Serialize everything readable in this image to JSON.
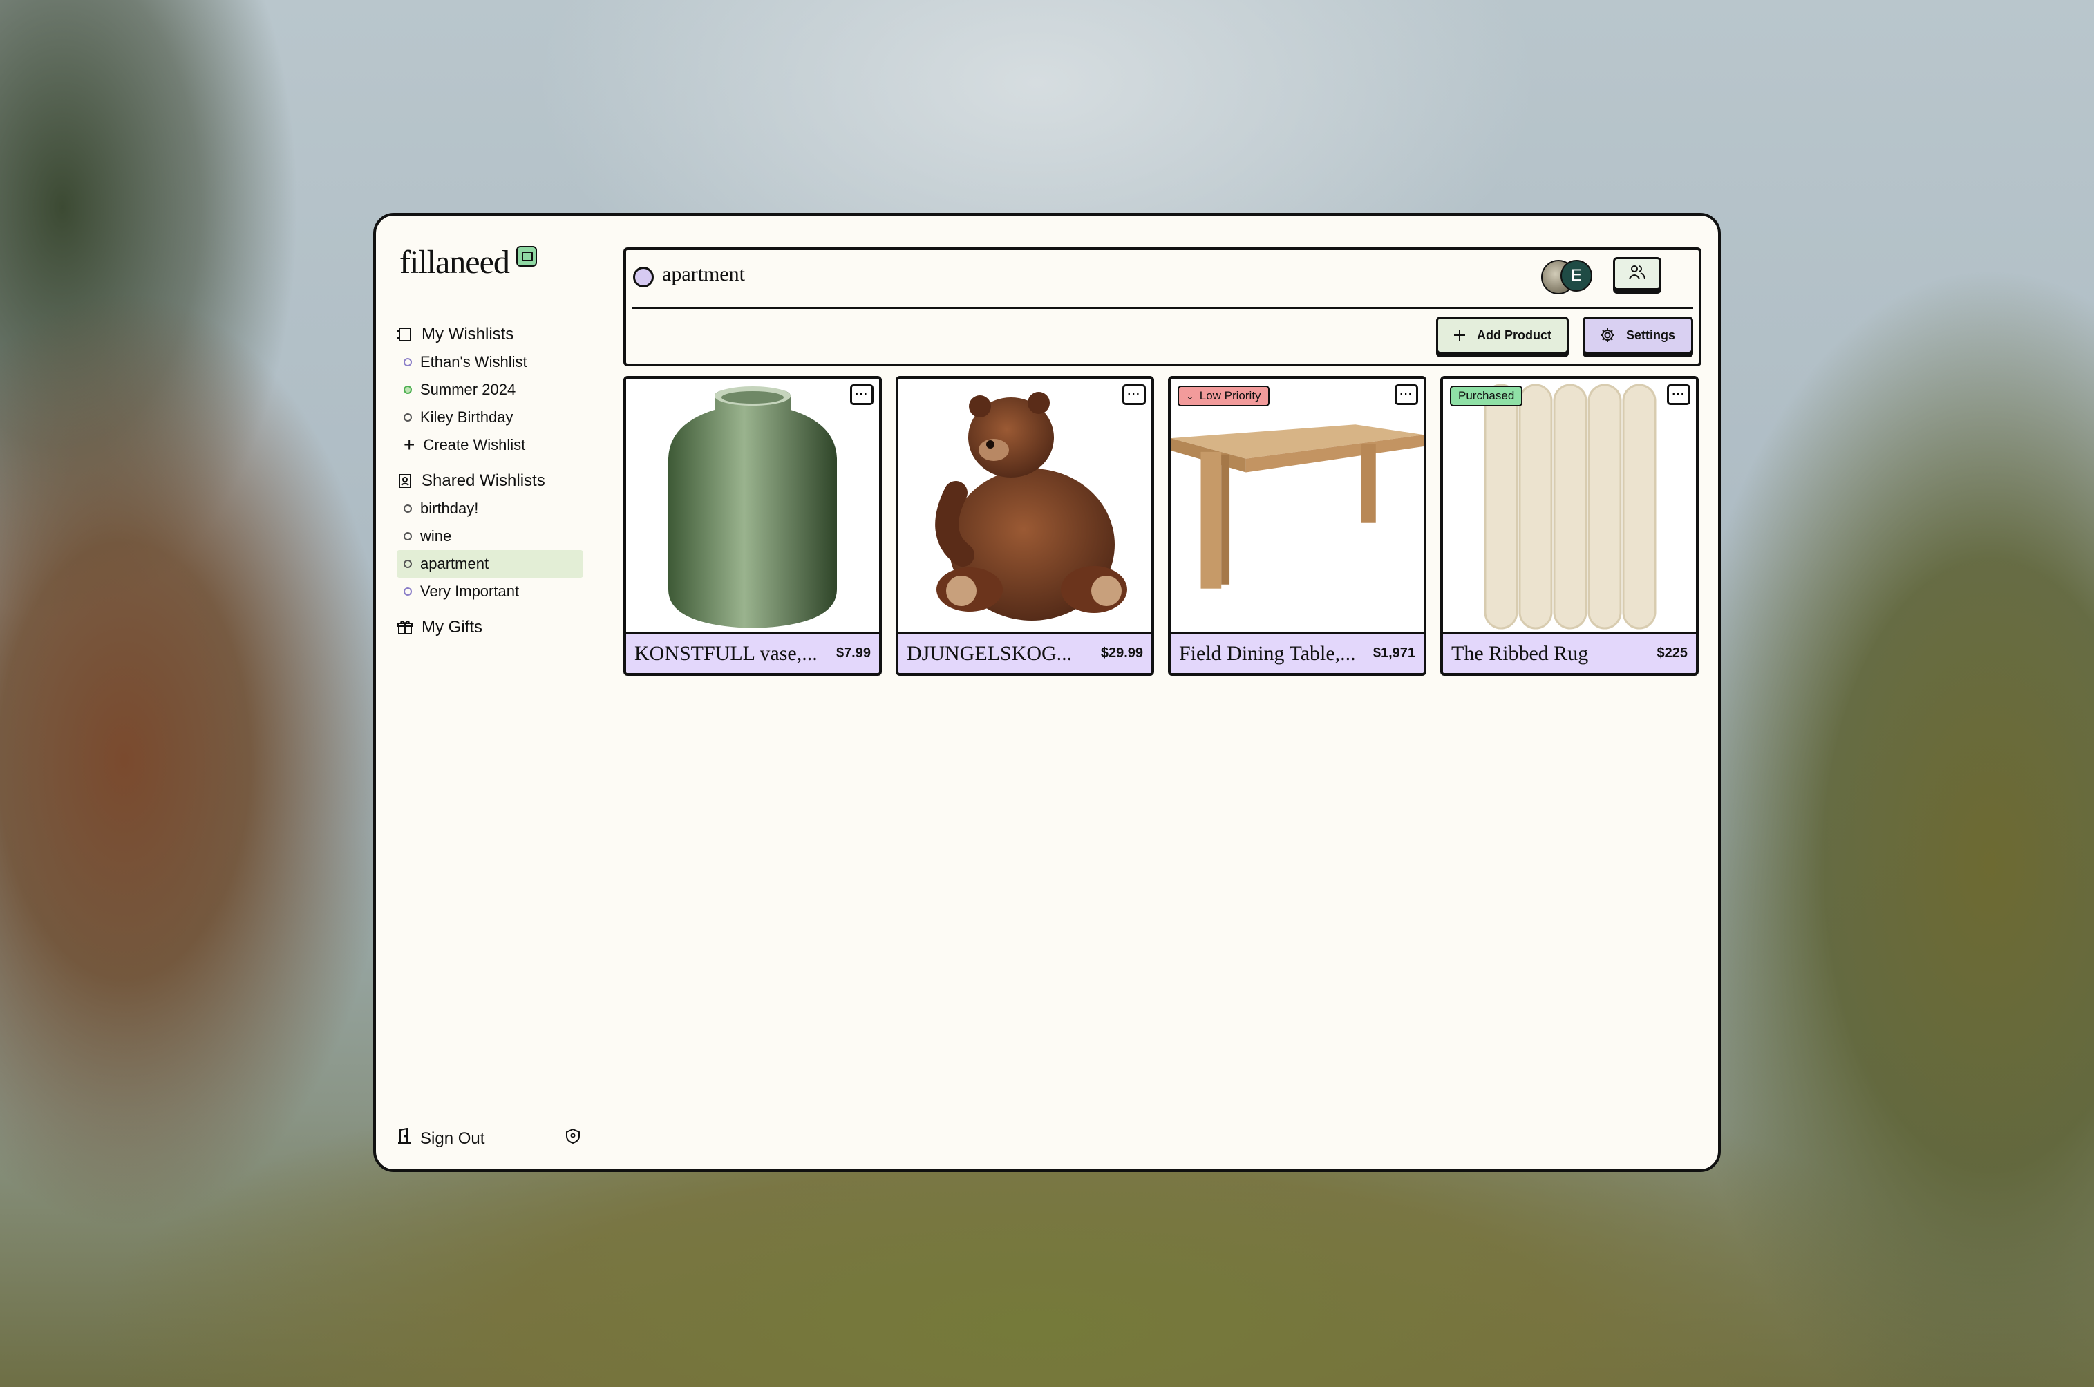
{
  "app": {
    "logo": "fillaneed"
  },
  "sidebar": {
    "my_wishlists": {
      "label": "My Wishlists",
      "items": [
        {
          "label": "Ethan's Wishlist",
          "color": "#8b7ec8"
        },
        {
          "label": "Summer 2024",
          "color": "#4caf50"
        },
        {
          "label": "Kiley Birthday",
          "color": "#555555"
        }
      ],
      "create_label": "Create Wishlist"
    },
    "shared_wishlists": {
      "label": "Shared Wishlists",
      "items": [
        {
          "label": "birthday!",
          "color": "#555555"
        },
        {
          "label": "wine",
          "color": "#555555"
        },
        {
          "label": "apartment",
          "color": "#555555",
          "active": true
        },
        {
          "label": "Very Important",
          "color": "#8b7ec8"
        }
      ]
    },
    "my_gifts_label": "My Gifts",
    "sign_out_label": "Sign Out"
  },
  "header": {
    "title": "apartment",
    "avatar_initial": "E",
    "add_product_label": "Add Product",
    "settings_label": "Settings"
  },
  "products": [
    {
      "name": "KONSTFULL vase,...",
      "price": "$7.99",
      "badge": "",
      "icon": "vase-image"
    },
    {
      "name": "DJUNGELSKOG...",
      "price": "$29.99",
      "badge": "",
      "icon": "bear-image"
    },
    {
      "name": "Field Dining Table,...",
      "price": "$1,971",
      "badge": "Low Priority",
      "icon": "table-image"
    },
    {
      "name": "The Ribbed Rug",
      "price": "$225",
      "badge": "Purchased",
      "icon": "rug-image"
    }
  ],
  "colors": {
    "accent_purple": "#e3d7fb",
    "accent_green": "#e4eedc",
    "low_priority": "#f29b9b",
    "purchased": "#8fe0a6"
  }
}
